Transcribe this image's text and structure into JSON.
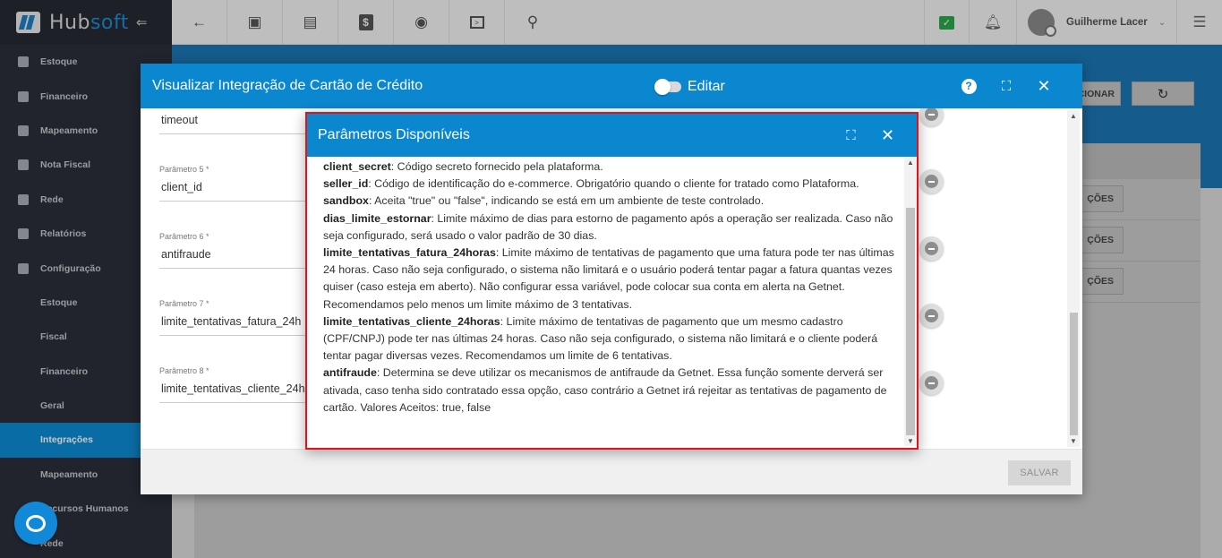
{
  "brand": {
    "hub": "Hub",
    "soft": "soft",
    "collapse_icon": "⇐"
  },
  "sidebar": {
    "items": [
      {
        "label": "Estoque",
        "icon": "cube-icon",
        "sub": false,
        "active": false
      },
      {
        "label": "Financeiro",
        "icon": "money-icon",
        "sub": false,
        "active": false
      },
      {
        "label": "Mapeamento",
        "icon": "map-pin-icon",
        "sub": false,
        "active": false
      },
      {
        "label": "Nota Fiscal",
        "icon": "document-icon",
        "sub": false,
        "active": false
      },
      {
        "label": "Rede",
        "icon": "server-icon",
        "sub": false,
        "active": false
      },
      {
        "label": "Relatórios",
        "icon": "report-icon",
        "sub": false,
        "active": false
      },
      {
        "label": "Configuração",
        "icon": "gear-icon",
        "sub": false,
        "active": false
      },
      {
        "label": "Estoque",
        "icon": "",
        "sub": true,
        "active": false
      },
      {
        "label": "Fiscal",
        "icon": "",
        "sub": true,
        "active": false
      },
      {
        "label": "Financeiro",
        "icon": "",
        "sub": true,
        "active": false
      },
      {
        "label": "Geral",
        "icon": "",
        "sub": true,
        "active": false
      },
      {
        "label": "Integrações",
        "icon": "",
        "sub": true,
        "active": true
      },
      {
        "label": "Mapeamento",
        "icon": "",
        "sub": true,
        "active": false
      },
      {
        "label": "Recursos Humanos",
        "icon": "",
        "sub": true,
        "active": false
      },
      {
        "label": "Rede",
        "icon": "",
        "sub": true,
        "active": false
      }
    ]
  },
  "topbar": {
    "user_name": "Guilherme Lacer",
    "buttons": [
      "back-arrow-icon",
      "contact-card-icon",
      "calendar-clock-icon",
      "dollar-icon",
      "eye-icon",
      "terminal-icon",
      "search-icon"
    ]
  },
  "background": {
    "add_button_label": "CIONAR",
    "row_button_label": "ÇÕES"
  },
  "outer_modal": {
    "title": "Visualizar Integração de Cartão de Crédito",
    "toggle_label": "Editar",
    "save_label": "SALVAR",
    "fields": [
      {
        "label": "",
        "value": "timeout"
      },
      {
        "label": "Parâmetro 5 *",
        "value": "client_id"
      },
      {
        "label": "Parâmetro 6 *",
        "value": "antifraude"
      },
      {
        "label": "Parâmetro 7 *",
        "value": "limite_tentativas_fatura_24h"
      },
      {
        "label": "Parâmetro 8 *",
        "value": "limite_tentativas_cliente_24h"
      }
    ]
  },
  "inner_modal": {
    "title": "Parâmetros Disponíveis",
    "params": [
      {
        "name": "client_secret",
        "desc": ": Código secreto fornecido pela plataforma."
      },
      {
        "name": "seller_id",
        "desc": ": Código de identificação do e-commerce. Obrigatório quando o cliente for tratado como Plataforma."
      },
      {
        "name": "sandbox",
        "desc": ": Aceita \"true\" ou \"false\", indicando se está em um ambiente de teste controlado."
      },
      {
        "name": "dias_limite_estornar",
        "desc": ": Limite máximo de dias para estorno de pagamento após a operação ser realizada. Caso não seja configurado, será usado o valor padrão de 30 dias."
      },
      {
        "name": "limite_tentativas_fatura_24horas",
        "desc": ": Limite máximo de tentativas de pagamento que uma fatura pode ter nas últimas 24 horas. Caso não seja configurado, o sistema não limitará e o usuário poderá tentar pagar a fatura quantas vezes quiser (caso esteja em aberto). Não configurar essa variável, pode colocar sua conta em alerta na Getnet. Recomendamos pelo menos um limite máximo de 3 tentativas."
      },
      {
        "name": "limite_tentativas_cliente_24horas",
        "desc": ": Limite máximo de tentativas de pagamento que um mesmo cadastro (CPF/CNPJ) pode ter nas últimas 24 horas. Caso não seja configurado, o sistema não limitará e o cliente poderá tentar pagar diversas vezes. Recomendamos um limite de 6 tentativas."
      },
      {
        "name": "antifraude",
        "desc": ": Determina se deve utilizar os mecanismos de antifraude da Getnet. Essa função somente derverá ser ativada, caso tenha sido contratado essa opção, caso contrário a Getnet irá rejeitar as tentativas de pagamento de cartão. Valores Aceitos: true, false"
      }
    ]
  },
  "colors": {
    "primary": "#0b87d0",
    "sidebar_bg": "#2b2f3a",
    "highlight_border": "#e0131b",
    "chat_green": "#2ba84a"
  }
}
